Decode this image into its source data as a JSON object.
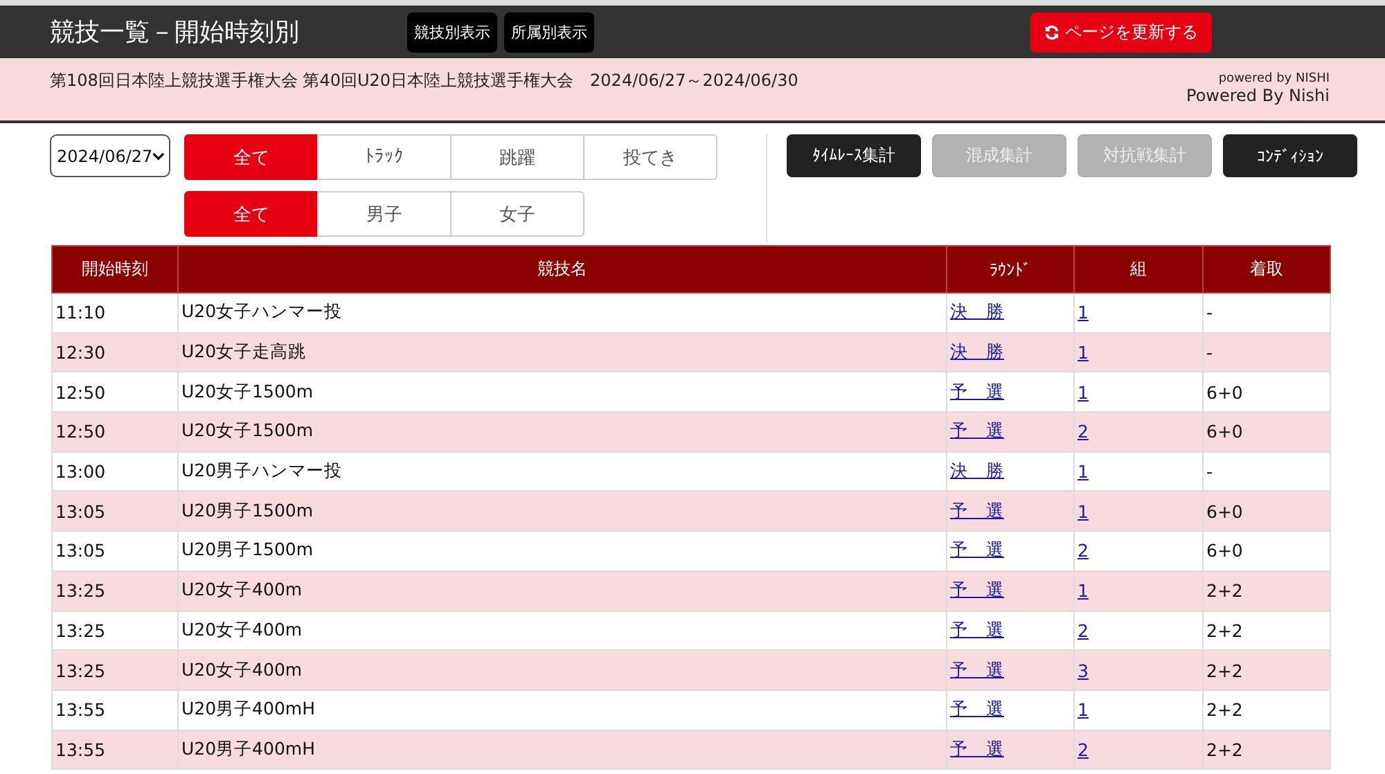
{
  "header": {
    "title": "競技一覧－開始時刻別",
    "view_buttons": [
      "競技別表示",
      "所属別表示"
    ],
    "refresh_button": "ページを更新する"
  },
  "info": {
    "meet": "第108回日本陸上競技選手権大会 第40回U20日本陸上競技選手権大会　2024/06/27～2024/06/30",
    "powered_small": "powered by NISHI",
    "powered": "Powered By Nishi"
  },
  "date_select": {
    "value": "2024/06/27"
  },
  "type_filter": [
    {
      "label": "全て",
      "selected": true
    },
    {
      "label": "ﾄﾗｯｸ",
      "selected": false
    },
    {
      "label": "跳躍",
      "selected": false
    },
    {
      "label": "投てき",
      "selected": false
    }
  ],
  "gender_filter": [
    {
      "label": "全て",
      "selected": true
    },
    {
      "label": "男子",
      "selected": false
    },
    {
      "label": "女子",
      "selected": false
    }
  ],
  "tool_buttons": [
    {
      "label": "ﾀｲﾑﾚｰｽ集計",
      "disabled": false
    },
    {
      "label": "混成集計",
      "disabled": true
    },
    {
      "label": "対抗戦集計",
      "disabled": true
    },
    {
      "label": "ｺﾝﾃﾞｨｼｮﾝ",
      "disabled": false
    }
  ],
  "table": {
    "columns": [
      "開始時刻",
      "競技名",
      "ﾗｳﾝﾄﾞ",
      "組",
      "着取"
    ],
    "rows": [
      [
        "11:10",
        "U20女子ハンマー投",
        "決　勝",
        "1",
        "-"
      ],
      [
        "12:30",
        "U20女子走高跳",
        "決　勝",
        "1",
        "-"
      ],
      [
        "12:50",
        "U20女子1500m",
        "予　選",
        "1",
        "6+0"
      ],
      [
        "12:50",
        "U20女子1500m",
        "予　選",
        "2",
        "6+0"
      ],
      [
        "13:00",
        "U20男子ハンマー投",
        "決　勝",
        "1",
        "-"
      ],
      [
        "13:05",
        "U20男子1500m",
        "予　選",
        "1",
        "6+0"
      ],
      [
        "13:05",
        "U20男子1500m",
        "予　選",
        "2",
        "6+0"
      ],
      [
        "13:25",
        "U20女子400m",
        "予　選",
        "1",
        "2+2"
      ],
      [
        "13:25",
        "U20女子400m",
        "予　選",
        "2",
        "2+2"
      ],
      [
        "13:25",
        "U20女子400m",
        "予　選",
        "3",
        "2+2"
      ],
      [
        "13:55",
        "U20男子400mH",
        "予　選",
        "1",
        "2+2"
      ],
      [
        "13:55",
        "U20男子400mH",
        "予　選",
        "2",
        "2+2"
      ]
    ]
  }
}
